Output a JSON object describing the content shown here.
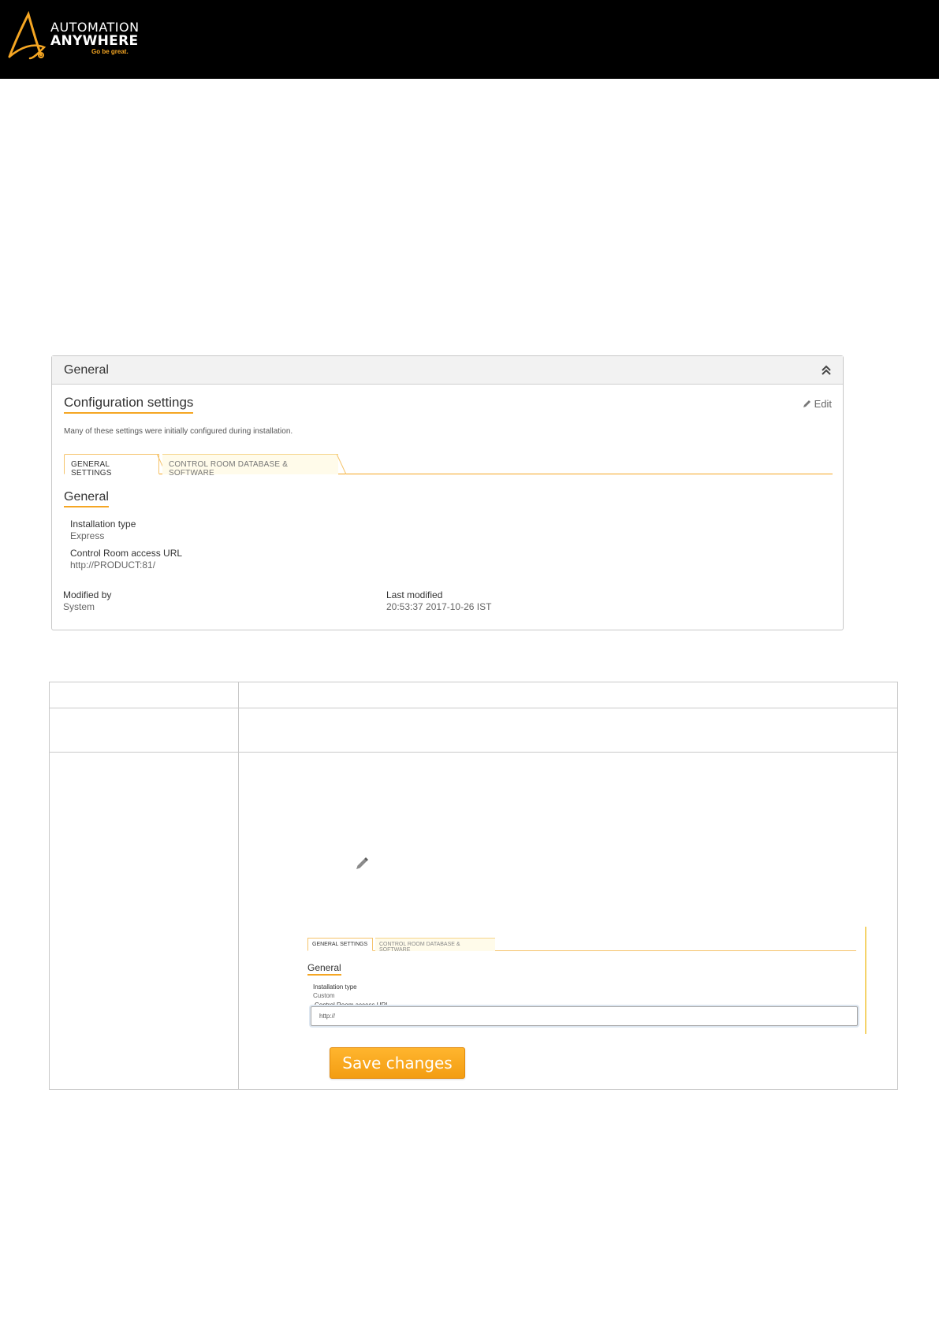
{
  "brand": {
    "line1": "AUTOMATION",
    "line2": "ANYWHERE",
    "tagline": "Go be great.",
    "accent": "#f5a623"
  },
  "panel": {
    "title": "General",
    "collapse_icon": "double-chevron-up-icon",
    "config_title": "Configuration settings",
    "edit_label": "Edit",
    "edit_icon": "pencil-icon",
    "description": "Many of these settings were initially configured during installation.",
    "tabs": [
      {
        "label": "GENERAL SETTINGS",
        "active": true
      },
      {
        "label": "CONTROL ROOM DATABASE & SOFTWARE",
        "active": false
      }
    ],
    "section_title": "General",
    "fields": [
      {
        "label": "Installation type",
        "value": "Express"
      },
      {
        "label": "Control Room access URL",
        "value": "http://PRODUCT:81/"
      }
    ],
    "modified_by_label": "Modified by",
    "modified_by_value": "System",
    "last_modified_label": "Last modified",
    "last_modified_value": "20:53:37 2017-10-26 IST"
  },
  "edit_form": {
    "tabs": [
      {
        "label": "GENERAL SETTINGS",
        "active": true
      },
      {
        "label": "CONTROL ROOM DATABASE & SOFTWARE",
        "active": false
      }
    ],
    "section_title": "General",
    "installation_label": "Installation type",
    "installation_value": "Custom",
    "url_label": "Control Room access URL",
    "url_value": "http://",
    "save_label": "Save changes"
  }
}
